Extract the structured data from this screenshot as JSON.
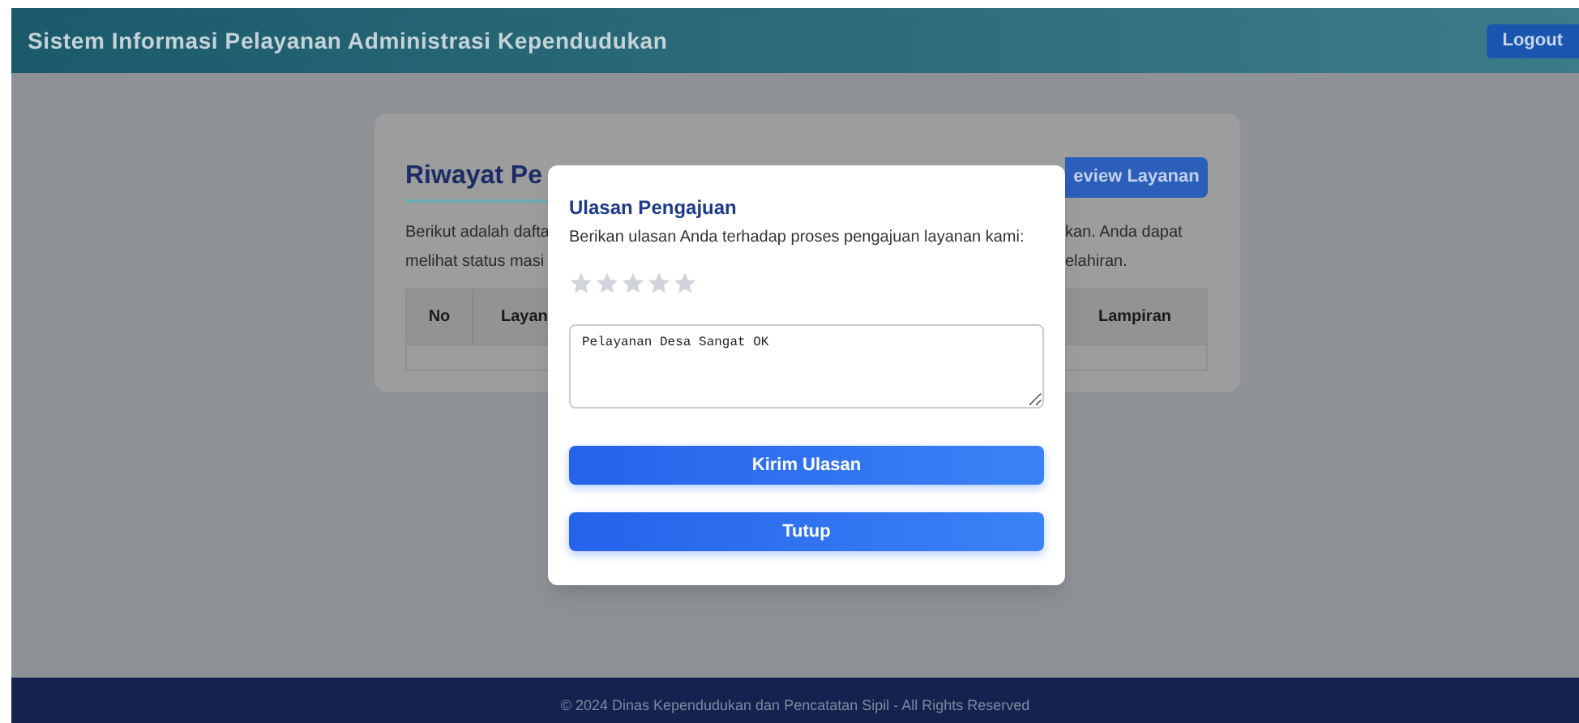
{
  "header": {
    "title": "Sistem Informasi Pelayanan Administrasi Kependudukan",
    "logout": "Logout"
  },
  "card": {
    "title": "Riwayat Pe",
    "review_button": "eview Layanan",
    "description_left": [
      "Berikut adalah dafta",
      "melihat status masi"
    ],
    "description_right": [
      "kan. Anda dapat",
      "elahiran."
    ],
    "columns": [
      "No",
      "Layan",
      "Lampiran"
    ]
  },
  "modal": {
    "title": "Ulasan Pengajuan",
    "subtitle": "Berikan ulasan Anda terhadap proses pengajuan layanan kami:",
    "stars": 0,
    "review_text": "Pelayanan Desa Sangat OK",
    "buttons": [
      "Kirim Ulasan",
      "Tutup"
    ]
  },
  "footer": "© 2024 Dinas Kependudukan dan Pencatatan Sipil - All Rights Reserved"
}
